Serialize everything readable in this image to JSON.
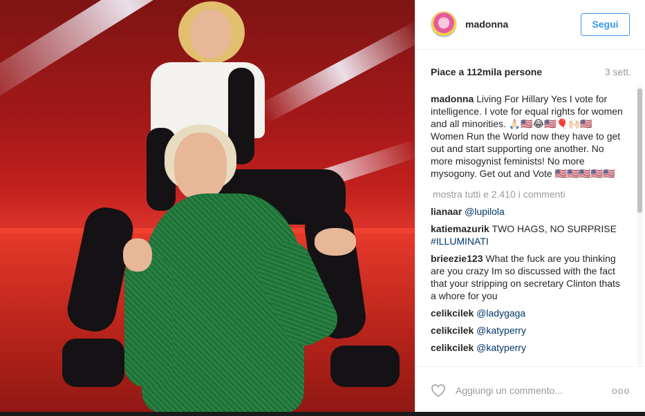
{
  "post": {
    "username": "madonna",
    "follow_label": "Segui",
    "likes_prefix": "Piace a ",
    "likes_count": "112mila",
    "likes_suffix": " persone",
    "time_ago": "3 sett."
  },
  "caption": {
    "author": "madonna",
    "text": "Living For Hillary Yes I vote for intelligence. I vote for equal rights for women and all minorities. 🙏🏻🇺🇸😂🇺🇸🎈🙌🏻🇺🇸 Women Run the World now they have to get out and start supporting one another. No more misogynist feminists! No more mysogony. Get out and Vote 🇺🇸🇺🇸🇺🇸🇺🇸🇺🇸"
  },
  "show_all_comments": "mostra tutti e 2.410 i commenti",
  "comments": [
    {
      "author": "lianaar",
      "text": "",
      "mention": "@lupilola"
    },
    {
      "author": "katiemazurik",
      "text": "TWO HAGS, NO SURPRISE",
      "mention": "#ILLUMINATI"
    },
    {
      "author": "brieezie123",
      "text": "What the fuck are you thinking are you crazy Im so discussed with the fact that your stripping on secretary Clinton thats a whore for you",
      "mention": ""
    },
    {
      "author": "celikcilek",
      "text": "",
      "mention": "@ladygaga"
    },
    {
      "author": "celikcilek",
      "text": "",
      "mention": "@katyperry"
    },
    {
      "author": "celikcilek",
      "text": "",
      "mention": "@katyperry"
    }
  ],
  "footer": {
    "comment_placeholder": "Aggiungi un commento...",
    "more_label": "ooo"
  },
  "icons": {
    "avatar": "avatar-icon",
    "like": "heart-icon",
    "more": "more-options-icon"
  },
  "colors": {
    "link_blue": "#3897f0",
    "mention_blue": "#003569",
    "muted": "#999999"
  }
}
